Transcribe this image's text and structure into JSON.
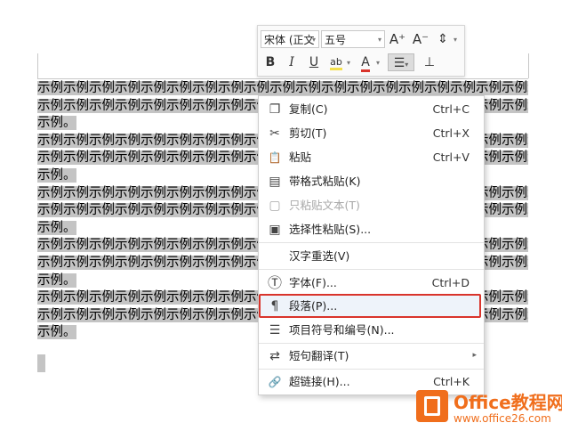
{
  "document": {
    "paragraphs": [
      {
        "lines": [
          "示例示例示例示例示例示例示例示例示例示例示例示例示例示例示例示例示例示例示例示例示例示例示例示例",
          "示例示例示例示例示例示例示例示例示例示例示例示例示例示例示例示例示例示例示例示例示例示例示例示例",
          "示例。"
        ]
      },
      {
        "lines": [
          "示例示例示例示例示例示例示例示例示例示例示例示例示例示例示例示例示例示例示例示例示例示例示例示例",
          "示例示例示例示例示例示例示例示例示例示例示例示例示例示例示例示例示例示例示例示例示例示例示例示例",
          "示例。"
        ]
      },
      {
        "lines": [
          "示例示例示例示例示例示例示例示例示例示例示例示例示例示例示例示例示例示例示例示例示例示例示例示例",
          "示例示例示例示例示例示例示例示例示例示例示例示例示例示例示例示例示例示例示例示例示例示例示例示例",
          "示例。"
        ]
      },
      {
        "lines": [
          "示例示例示例示例示例示例示例示例示例示例示例示例示例示例示例示例示例示例示例示例示例示例示例示例",
          "示例示例示例示例示例示例示例示例示例示例示例示例示例示例示例示例示例示例示例示例示例示例示例示例",
          "示例。"
        ]
      },
      {
        "lines": [
          "示例示例示例示例示例示例示例示例示例示例示例示例示例示例示例示例示例示例示例示例示例示例示例示例",
          "示例示例示例示例示例示例示例示例示例示例示例示例示例示例示例示例示例示例示例示例示例示例示例示例",
          "示例。"
        ]
      }
    ]
  },
  "mini_toolbar": {
    "font_name": "宋体 (正文",
    "font_size": "五号",
    "grow_font": "A⁺",
    "shrink_font": "A⁻",
    "bold": "B",
    "italic": "I",
    "underline": "U",
    "highlight": "ab",
    "font_color": "A"
  },
  "context_menu": {
    "items": [
      {
        "label": "复制(C)",
        "shortcut": "Ctrl+C",
        "icon": "copy-icon",
        "glyph": "❐",
        "enabled": true
      },
      {
        "label": "剪切(T)",
        "shortcut": "Ctrl+X",
        "icon": "scissors-icon",
        "glyph": "✂",
        "enabled": true
      },
      {
        "label": "粘贴",
        "shortcut": "Ctrl+V",
        "icon": "paste-icon",
        "glyph": "📋",
        "enabled": true
      },
      {
        "label": "带格式粘贴(K)",
        "shortcut": "",
        "icon": "paste-formatted-icon",
        "glyph": "▤",
        "enabled": true
      },
      {
        "label": "只粘贴文本(T)",
        "shortcut": "",
        "icon": "paste-text-icon",
        "glyph": "▢",
        "enabled": false
      },
      {
        "label": "选择性粘贴(S)...",
        "shortcut": "",
        "icon": "paste-special-icon",
        "glyph": "▣",
        "enabled": true
      },
      {
        "label": "汉字重选(V)",
        "shortcut": "",
        "icon": "",
        "glyph": "",
        "enabled": true
      },
      {
        "label": "字体(F)...",
        "shortcut": "Ctrl+D",
        "icon": "font-icon",
        "glyph": "Ⓣ",
        "enabled": true
      },
      {
        "label": "段落(P)...",
        "shortcut": "",
        "icon": "paragraph-icon",
        "glyph": "¶",
        "enabled": true,
        "highlighted": true
      },
      {
        "label": "项目符号和编号(N)...",
        "shortcut": "",
        "icon": "bullet-list-icon",
        "glyph": "☰",
        "enabled": true
      },
      {
        "label": "短句翻译(T)",
        "shortcut": "",
        "icon": "translate-icon",
        "glyph": "⇄",
        "enabled": true,
        "submenu": true
      },
      {
        "label": "超链接(H)...",
        "shortcut": "Ctrl+K",
        "icon": "link-icon",
        "glyph": "🔗",
        "enabled": true
      }
    ]
  },
  "watermark": {
    "title": "Office教程网",
    "url": "www.office26.com"
  }
}
